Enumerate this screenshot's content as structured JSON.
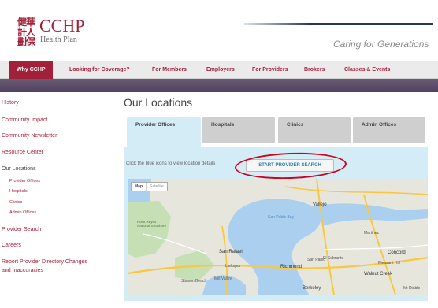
{
  "header": {
    "logo_chinese": "健華\n計人\n劃保",
    "logo_name": "CCHP",
    "logo_subtitle": "Health Plan",
    "tagline": "Caring for Generations"
  },
  "nav": {
    "items": [
      {
        "label": "Why CCHP"
      },
      {
        "label": "Looking for Coverage?"
      },
      {
        "label": "For Members"
      },
      {
        "label": "Employers"
      },
      {
        "label": "For Providers"
      },
      {
        "label": "Brokers"
      },
      {
        "label": "Classes & Events"
      }
    ]
  },
  "sidebar": {
    "items": [
      {
        "label": "History"
      },
      {
        "label": "Community Impact"
      },
      {
        "label": "Community Newsletter"
      },
      {
        "label": "Resource Center"
      },
      {
        "label": "Our Locations"
      },
      {
        "label": "Provider Offices"
      },
      {
        "label": "Hospitals"
      },
      {
        "label": "Clinics"
      },
      {
        "label": "Admin Offices"
      },
      {
        "label": "Provider Search"
      },
      {
        "label": "Careers"
      },
      {
        "label": "Report Provider Directory Changes"
      },
      {
        "label": "and Inaccuracies"
      }
    ]
  },
  "main": {
    "title": "Our Locations",
    "tabs": [
      {
        "label": "Provider Offices"
      },
      {
        "label": "Hospitals"
      },
      {
        "label": "Clinics"
      },
      {
        "label": "Admin Offices"
      }
    ],
    "instruction": "Click the blue icons to view location details",
    "search_button": "START PROVIDER SEARCH"
  },
  "map": {
    "toggle_map": "Map",
    "toggle_satellite": "Satellite",
    "places": [
      "Vallejo",
      "San Pablo Bay",
      "Point Reyes National Seashore",
      "San Rafael",
      "Richmond",
      "Concord",
      "Walnut Creek",
      "Berkeley",
      "Mill Valley",
      "Stinson Beach",
      "Martinez",
      "El Sobrante",
      "Pleasant Hill",
      "San Pablo",
      "Mt Diablo",
      "Larkspur"
    ]
  },
  "colors": {
    "brand": "#a3203a",
    "banner": "#574a67",
    "panel": "#d4ecf5",
    "highlight_oval": "#d0021b",
    "button_text": "#2c7fa8"
  }
}
